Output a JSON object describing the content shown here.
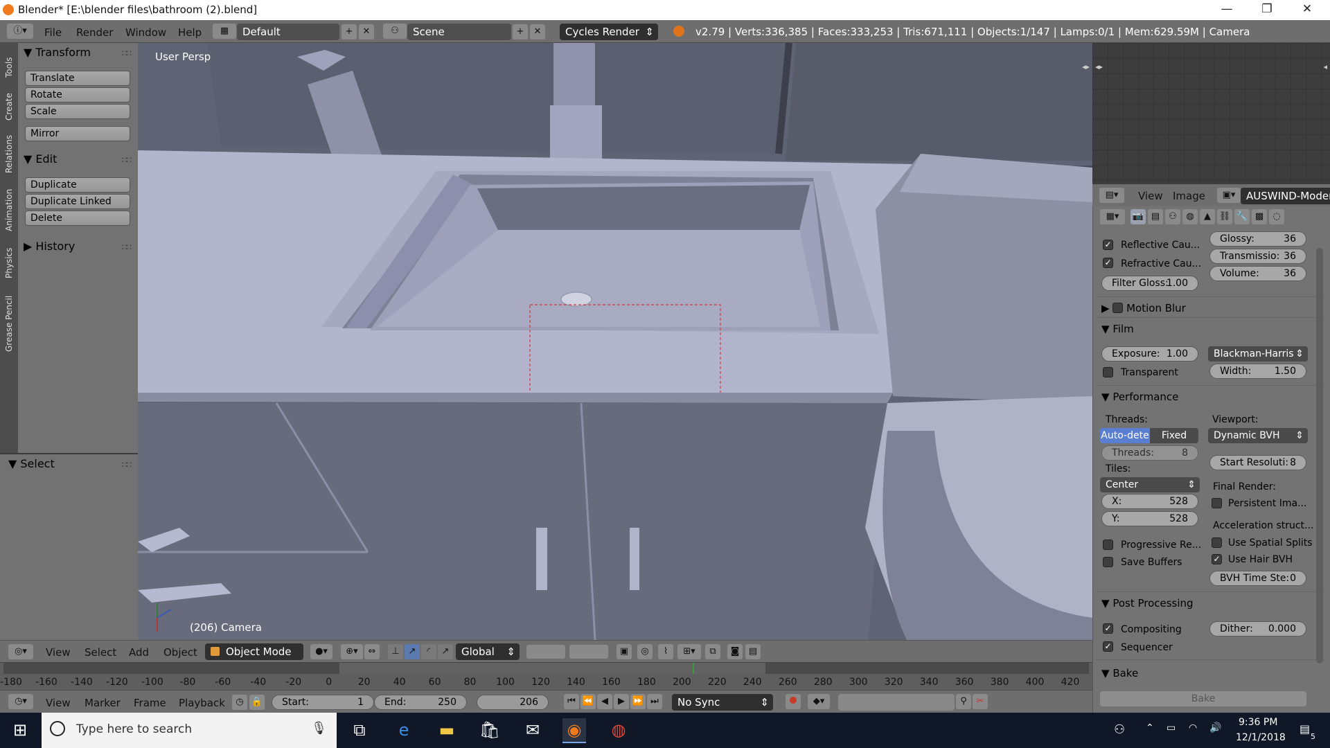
{
  "window": {
    "title": "Blender* [E:\\blender files\\bathroom (2).blend]",
    "minimize": "—",
    "restore": "❐",
    "close": "✕"
  },
  "topbar": {
    "menus": [
      "File",
      "Render",
      "Window",
      "Help"
    ],
    "layout": "Default",
    "scene": "Scene",
    "engine": "Cycles Render",
    "stats": "v2.79 | Verts:336,385 | Faces:333,253 | Tris:671,111 | Objects:1/147 | Lamps:0/1 | Mem:629.59M | Camera"
  },
  "tooltabs": [
    "Tools",
    "Create",
    "Relations",
    "Animation",
    "Physics",
    "Grease Pencil"
  ],
  "toolshelf": {
    "transform": {
      "title": "Transform",
      "buttons": [
        "Translate",
        "Rotate",
        "Scale",
        "Mirror"
      ]
    },
    "edit": {
      "title": "Edit",
      "buttons": [
        "Duplicate",
        "Duplicate Linked",
        "Delete"
      ]
    },
    "history": {
      "title": "History"
    },
    "select": {
      "title": "Select"
    }
  },
  "viewport": {
    "label": "User Persp",
    "object_info": "(206) Camera",
    "colors": {
      "bg": "#5f6474",
      "surface": "#a9abc3",
      "light": "#b7b9d0",
      "dark": "#6e7182"
    }
  },
  "vphead": {
    "menus": [
      "View",
      "Select",
      "Add",
      "Object"
    ],
    "mode": "Object Mode",
    "orientation": "Global"
  },
  "ruler": {
    "ticks": [
      "-180",
      "-160",
      "-140",
      "-120",
      "-100",
      "-80",
      "-60",
      "-40",
      "-20",
      "0",
      "20",
      "40",
      "60",
      "80",
      "100",
      "120",
      "140",
      "160",
      "180",
      "200",
      "220",
      "240",
      "260",
      "280",
      "300",
      "320",
      "340",
      "360",
      "380",
      "400",
      "420"
    ],
    "current_frame_value": 206
  },
  "timeline": {
    "menus": [
      "View",
      "Marker",
      "Frame",
      "Playback"
    ],
    "start_label": "Start:",
    "start": "1",
    "end_label": "End:",
    "end": "250",
    "current": "206",
    "sync": "No Sync"
  },
  "imghead": {
    "menus": [
      "View",
      "Image"
    ],
    "image_name": "AUSWIND-Modern"
  },
  "props": {
    "caustics": {
      "reflective": "Reflective Cau...",
      "refractive": "Refractive Cau...",
      "filter_gloss_label": "Filter Gloss:",
      "filter_gloss": "1.00",
      "glossy_label": "Glossy:",
      "glossy": "36",
      "transmission_label": "Transmissio:",
      "transmission": "36",
      "volume_label": "Volume:",
      "volume": "36"
    },
    "motion_blur": "Motion Blur",
    "film": {
      "title": "Film",
      "exposure_label": "Exposure:",
      "exposure": "1.00",
      "filter": "Blackman-Harris",
      "transparent": "Transparent",
      "width_label": "Width:",
      "width": "1.50"
    },
    "performance": {
      "title": "Performance",
      "threads_label": "Threads:",
      "auto": "Auto-dete",
      "fixed": "Fixed",
      "threads_count_label": "Threads:",
      "threads_count": "8",
      "viewport_label": "Viewport:",
      "bvh": "Dynamic BVH",
      "start_res_label": "Start Resoluti:",
      "start_res": "8",
      "tiles_label": "Tiles:",
      "tiles_order": "Center",
      "x_label": "X:",
      "x": "528",
      "y_label": "Y:",
      "y": "528",
      "final_render_label": "Final Render:",
      "persistent": "Persistent Ima...",
      "accel_label": "Acceleration struct...",
      "spatial": "Use Spatial Splits",
      "hair": "Use Hair BVH",
      "bvh_time_label": "BVH Time Ste:",
      "bvh_time": "0",
      "progressive": "Progressive Re...",
      "save_buffers": "Save Buffers"
    },
    "post": {
      "title": "Post Processing",
      "compositing": "Compositing",
      "sequencer": "Sequencer",
      "dither_label": "Dither:",
      "dither": "0.000"
    },
    "bake": {
      "title": "Bake",
      "button": "Bake"
    }
  },
  "taskbar": {
    "search_placeholder": "Type here to search",
    "time": "9:36 PM",
    "date": "12/1/2018",
    "notifications": "5"
  }
}
